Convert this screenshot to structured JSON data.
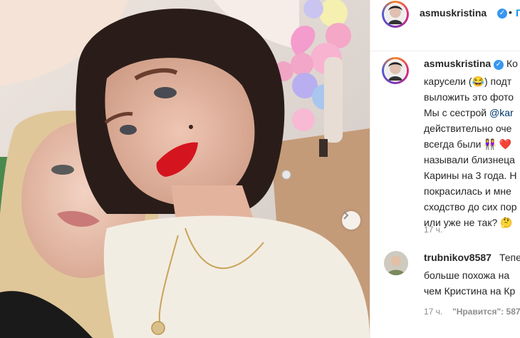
{
  "post": {
    "username": "asmuskristina",
    "follow_label": "П",
    "caption_lines": [
      "Ко",
      "карусели (😂) подт",
      "выложить это фото",
      "Мы с сестрой @kar",
      "действительно оче",
      "всегда были 👭 ❤️",
      "называли близнеца",
      "Карины на 3 года. Н",
      "покрасилась и мне",
      "сходство до сих пор",
      "или уже не так? 🤔"
    ],
    "caption_mention": "@kar",
    "caption_time": "17 ч."
  },
  "comment": {
    "username": "trubnikov8587",
    "lines": [
      "Тепе",
      "больше похожа на",
      "чем Кристина на Кр"
    ],
    "time": "17 ч.",
    "likes": "\"Нравится\": 587"
  },
  "icons": {
    "verified": "verified-badge-icon",
    "next": "chevron-right-icon"
  },
  "colors": {
    "accent": "#0095f6",
    "verified": "#3897f0",
    "lipstick": "#d4151f"
  }
}
